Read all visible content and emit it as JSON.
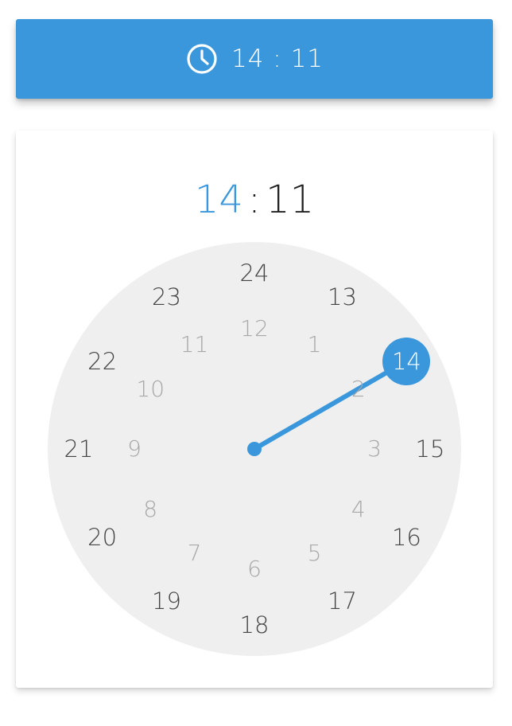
{
  "toolbar": {
    "icon": "clock-icon",
    "time_text": "14 : 11"
  },
  "picker": {
    "hour": "14",
    "separator": ":",
    "minute": "11",
    "selected_hour": 14
  },
  "dial": {
    "outer_labels": [
      "24",
      "13",
      "14",
      "15",
      "16",
      "17",
      "18",
      "19",
      "20",
      "21",
      "22",
      "23"
    ],
    "inner_labels": [
      "12",
      "1",
      "2",
      "3",
      "4",
      "5",
      "6",
      "7",
      "8",
      "9",
      "10",
      "11"
    ]
  },
  "colors": {
    "accent": "#3a97db",
    "dial_bg": "#efefef",
    "outer_text": "#444444",
    "inner_text": "#a8a8a8"
  }
}
